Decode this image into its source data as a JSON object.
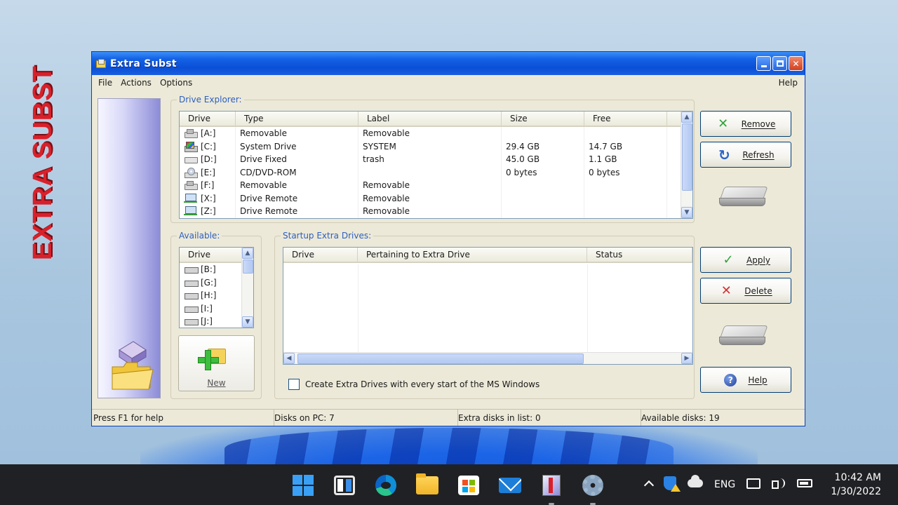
{
  "window": {
    "title": "Extra Subst",
    "menu": [
      "File",
      "Actions",
      "Options"
    ],
    "menu_help": "Help",
    "banner_text": "EXTRA SUBST"
  },
  "drive_explorer": {
    "title": "Drive Explorer:",
    "columns": [
      "Drive",
      "Type",
      "Label",
      "Size",
      "Free"
    ],
    "rows": [
      {
        "drive": "[A:]",
        "icon": "removable-drive-icon",
        "type": "Removable",
        "label": "Removable",
        "size": "",
        "free": ""
      },
      {
        "drive": "[C:]",
        "icon": "system-drive-icon",
        "type": "System Drive",
        "label": "SYSTEM",
        "size": "29.4 GB",
        "free": "14.7 GB"
      },
      {
        "drive": "[D:]",
        "icon": "fixed-drive-icon",
        "type": "Drive Fixed",
        "label": "trash",
        "size": "45.0 GB",
        "free": "1.1 GB"
      },
      {
        "drive": "[E:]",
        "icon": "cd-drive-icon",
        "type": "CD/DVD-ROM",
        "label": "",
        "size": "0 bytes",
        "free": "0 bytes"
      },
      {
        "drive": "[F:]",
        "icon": "removable-drive-icon",
        "type": "Removable",
        "label": "Removable",
        "size": "",
        "free": ""
      },
      {
        "drive": "[X:]",
        "icon": "remote-drive-icon",
        "type": "Drive Remote",
        "label": "Removable",
        "size": "",
        "free": ""
      },
      {
        "drive": "[Z:]",
        "icon": "remote-drive-icon",
        "type": "Drive Remote",
        "label": "Removable",
        "size": "",
        "free": ""
      }
    ]
  },
  "available": {
    "title": "Available:",
    "column": "Drive",
    "items": [
      "[B:]",
      "[G:]",
      "[H:]",
      "[I:]",
      "[J:]"
    ]
  },
  "new_button": "New",
  "startup": {
    "title": "Startup Extra Drives:",
    "columns": [
      "Drive",
      "Pertaining to Extra Drive",
      "Status"
    ],
    "checkbox_label": "Create Extra Drives with every start of the MS Windows"
  },
  "buttons": {
    "remove": "Remove",
    "refresh": "Refresh",
    "apply": "Apply",
    "delete": "Delete",
    "help": "Help"
  },
  "status": {
    "hint": "Press F1 for help",
    "disks_on_pc": "Disks on PC: 7",
    "extra_disks": "Extra disks in list: 0",
    "available_disks": "Available disks: 19"
  },
  "taskbar": {
    "icons": [
      "windows-start-icon",
      "task-view-icon",
      "edge-icon",
      "file-explorer-icon",
      "store-icon",
      "mail-icon",
      "extra-subst-icon",
      "settings-icon"
    ],
    "lang": "ENG",
    "time": "10:42 AM",
    "date": "1/30/2022"
  }
}
